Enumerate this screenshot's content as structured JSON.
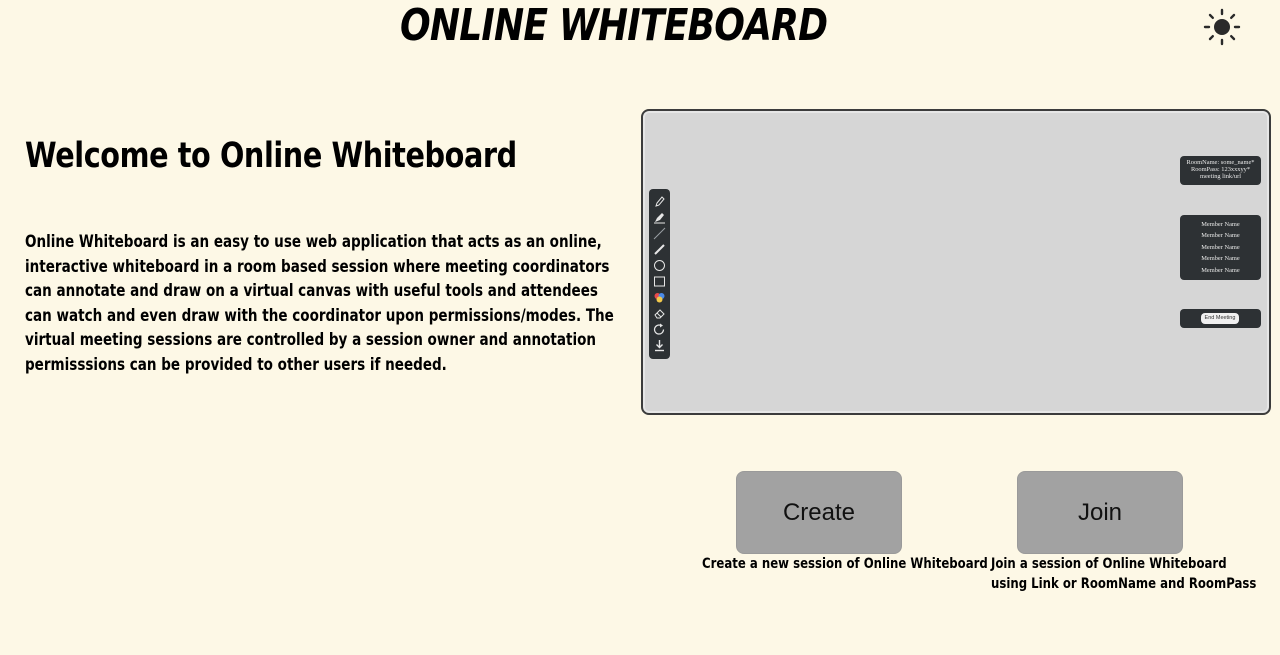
{
  "header": {
    "title": "ONLINE WHITEBOARD",
    "theme_toggle_icon": "sun-icon"
  },
  "intro": {
    "heading": "Welcome to Online Whiteboard",
    "description": "Online Whiteboard is an easy to use web application that acts as an online, interactive whiteboard in a room based session where meeting coordinators can annotate and draw on a virtual canvas with useful tools and attendees can watch and even draw with the coordinator upon permissions/modes. The virtual meeting sessions are controlled by a session owner and annotation permisssions can be provided to other users if needed."
  },
  "preview": {
    "toolbar_icons": [
      "pencil-icon",
      "highlighter-icon",
      "line-icon",
      "brush-icon",
      "circle-icon",
      "rectangle-icon",
      "color-palette-icon",
      "eraser-icon",
      "reset-icon",
      "download-icon"
    ],
    "room_info": {
      "room_name": "RoomName: some_name*",
      "room_pass": "RoomPass: 123xxxyy*",
      "link": "meeting link/url"
    },
    "members": [
      "Member Name",
      "Member Name",
      "Member Name",
      "Member Name",
      "Member Name"
    ],
    "end_meeting_label": "End Meeting"
  },
  "actions": {
    "create": {
      "label": "Create",
      "caption": "Create a new session of Online Whiteboard"
    },
    "join": {
      "label": "Join",
      "caption_line1": "Join a session of Online Whiteboard",
      "caption_line2": "using Link or RoomName and RoomPass"
    }
  },
  "colors": {
    "background": "#fdf8e6",
    "preview_canvas": "#d6d6d6",
    "panel_dark": "#2d3134",
    "button_gray": "#a2a2a2"
  }
}
